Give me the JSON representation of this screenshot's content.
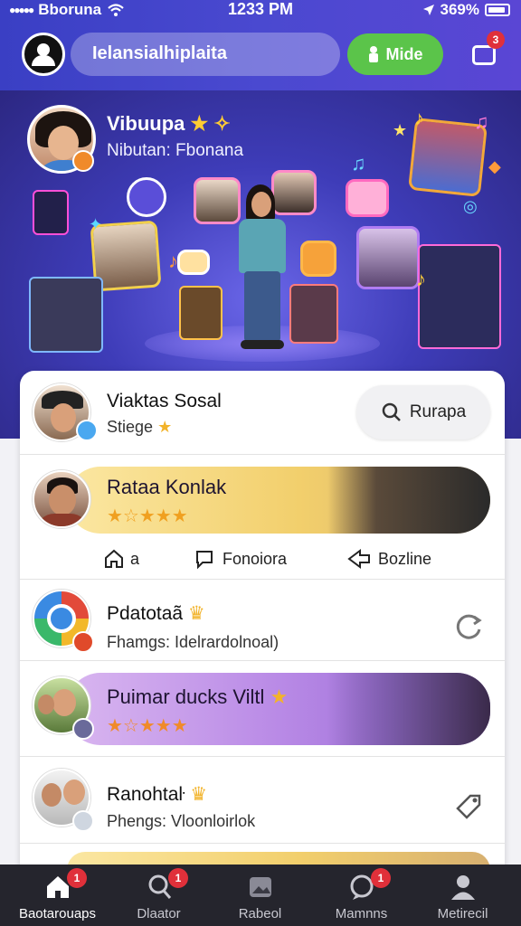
{
  "status_bar": {
    "carrier": "Bboruna",
    "time": "1233 PM",
    "battery": "369%"
  },
  "header": {
    "search_text": "Ielansialhiplaita",
    "mode_button": "Mide",
    "notification_count": "3"
  },
  "hero": {
    "title": "Vibuupa",
    "subtitle": "Nibutan: Fbonana"
  },
  "feed": {
    "profile": {
      "name": "Viaktas Sosal",
      "sub": "Stiege",
      "search_label": "Rurapa"
    },
    "featured_1": {
      "name": "Rataa Konlak",
      "stars": "★☆★★★"
    },
    "actions": [
      {
        "label": "a"
      },
      {
        "label": "Fonoiora"
      },
      {
        "label": "Bozline"
      }
    ],
    "item_1": {
      "name": "Pdatotaã",
      "sub": "Fhamgs: Idelrardolnoal)"
    },
    "featured_2": {
      "name": "Puimar ducks Viltl",
      "stars": "★☆★★★"
    },
    "item_2": {
      "name": "Ranohtaŀ",
      "sub": "Phengs: Vloonloirlok"
    }
  },
  "tabs": [
    {
      "label": "Baotarouaps",
      "badge": "1"
    },
    {
      "label": "Dlaator",
      "badge": "1"
    },
    {
      "label": "Rabeol",
      "badge": ""
    },
    {
      "label": "Mamnns",
      "badge": "1"
    },
    {
      "label": "Metirecil",
      "badge": ""
    }
  ],
  "colors": {
    "header": "#4147c8",
    "accent_green": "#5bc44a",
    "badge_red": "#e0303a",
    "band_yellow": "#f2cf6c",
    "band_purple": "#b98ae6",
    "tabbar": "#25252d"
  }
}
